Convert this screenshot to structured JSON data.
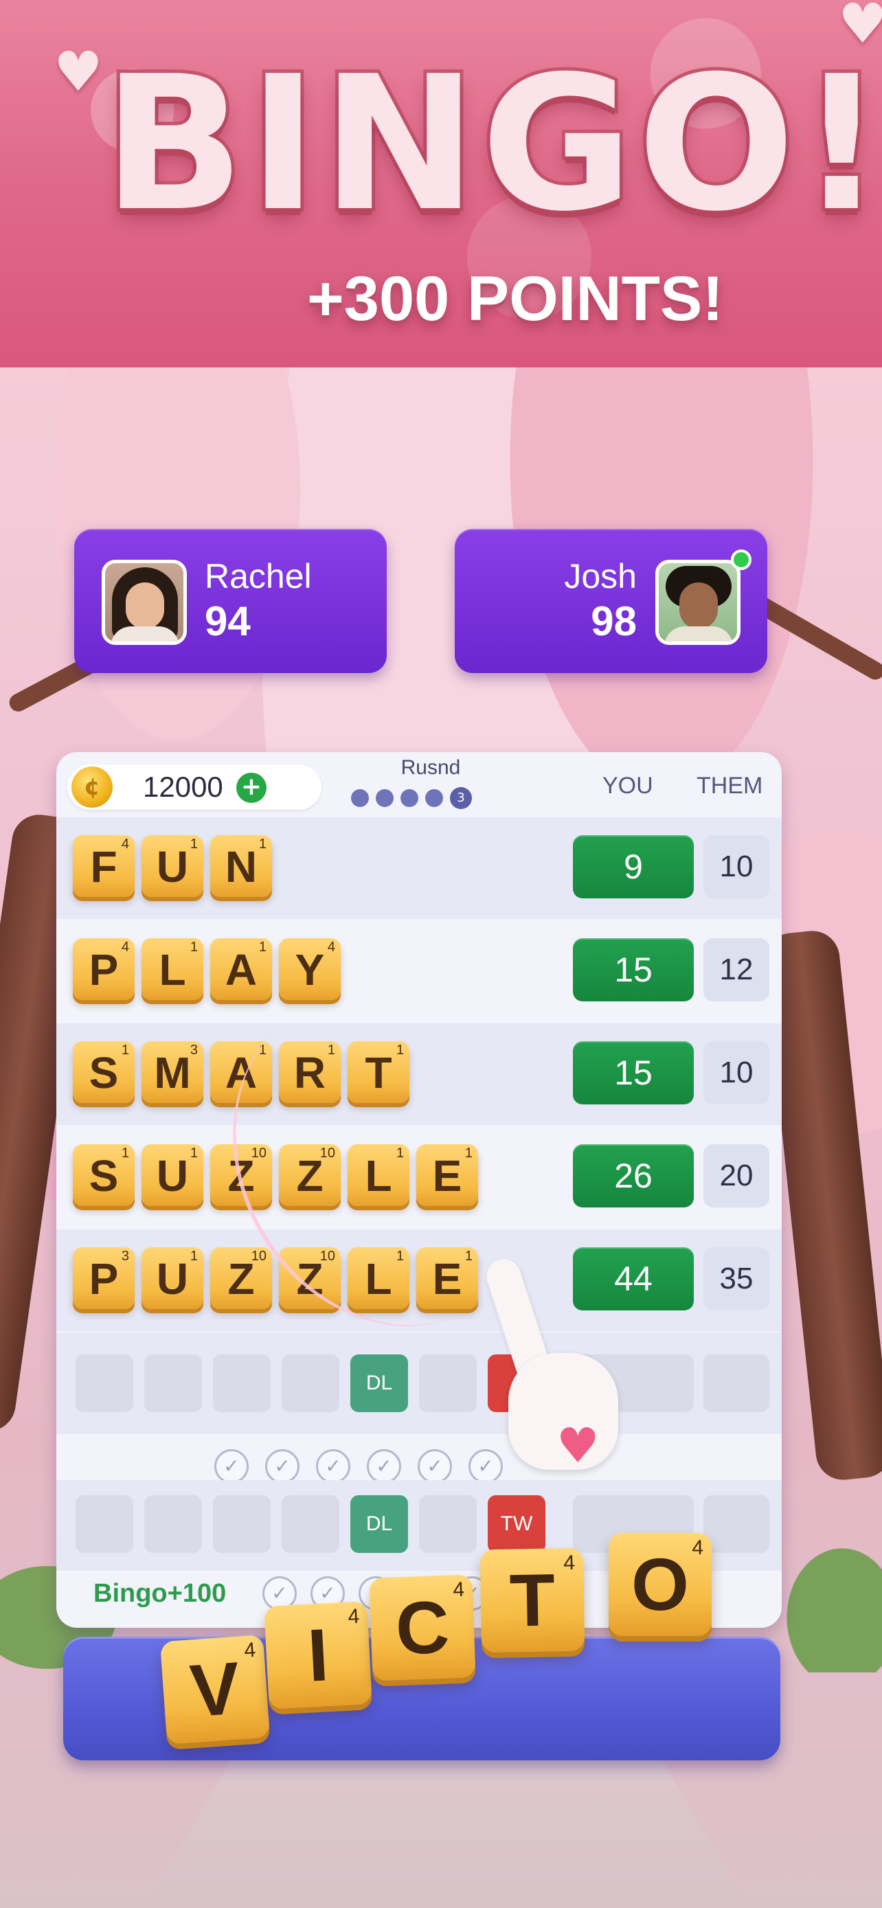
{
  "banner": {
    "title": "BINGO!",
    "subtitle": "+300 POINTS!"
  },
  "players": {
    "left": {
      "name": "Rachel",
      "score": "94"
    },
    "right": {
      "name": "Josh",
      "score": "98",
      "online": true
    }
  },
  "board": {
    "coins": "12000",
    "coin_icon": "coin-icon",
    "add_icon": "plus-icon",
    "round_label": "Rusnd",
    "round_dots": 5,
    "current_round": "3",
    "col_you": "YOU",
    "col_them": "THEM",
    "words": [
      {
        "letters": [
          "F",
          "U",
          "N"
        ],
        "points": [
          "4",
          "1",
          "1"
        ],
        "you": "9",
        "them": "10"
      },
      {
        "letters": [
          "P",
          "L",
          "A",
          "Y"
        ],
        "points": [
          "4",
          "1",
          "1",
          "4"
        ],
        "you": "15",
        "them": "12"
      },
      {
        "letters": [
          "S",
          "M",
          "A",
          "R",
          "T"
        ],
        "points": [
          "1",
          "3",
          "1",
          "1",
          "1"
        ],
        "you": "15",
        "them": "10"
      },
      {
        "letters": [
          "S",
          "U",
          "Z",
          "Z",
          "L",
          "E"
        ],
        "points": [
          "1",
          "1",
          "10",
          "10",
          "1",
          "1"
        ],
        "you": "26",
        "them": "20"
      },
      {
        "letters": [
          "P",
          "U",
          "Z",
          "Z",
          "L",
          "E"
        ],
        "points": [
          "3",
          "1",
          "10",
          "10",
          "1",
          "1"
        ],
        "you": "44",
        "them": "35"
      }
    ],
    "bonus_dl": "DL",
    "bonus_tw": "TW",
    "bingo_label": "Bingo+100",
    "check_icon": "check-icon"
  },
  "rack": {
    "letters": [
      "V",
      "I",
      "C",
      "T",
      "O"
    ],
    "points": [
      "4",
      "4",
      "4",
      "4",
      "4"
    ]
  },
  "colors": {
    "accent_purple": "#6b26cf",
    "score_green": "#16873d",
    "tile_gold": "#f6bb44",
    "dl_green": "#47a37f",
    "tw_red": "#d8413c",
    "rack_blue": "#545ad6"
  }
}
